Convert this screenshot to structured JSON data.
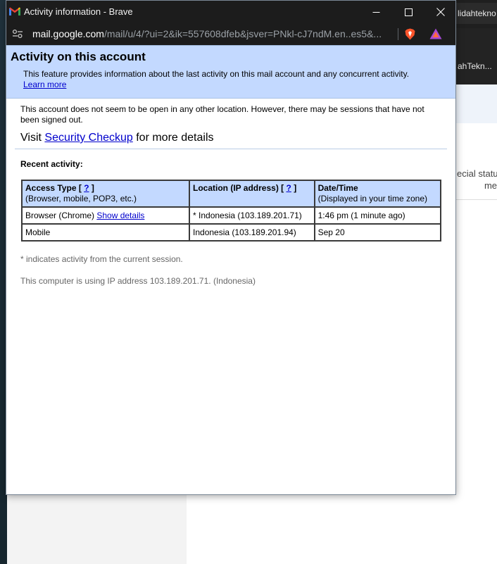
{
  "background": {
    "tab_label": "lidahtekno",
    "bookmark_label": "ahTekn...",
    "status_line1": "ecial statu",
    "status_line2": "me"
  },
  "window": {
    "title": "Activity information - Brave",
    "url_host": "mail.google.com",
    "url_path": "/mail/u/4/?ui=2&ik=557608dfeb&jsver=PNkl-cJ7ndM.en..es5&..."
  },
  "header": {
    "title": "Activity on this account",
    "description": "This feature provides information about the last activity on this mail account and any concurrent activity.",
    "learn_more": "Learn more"
  },
  "intro": "This account does not seem to be open in any other location. However, there may be sessions that have not been signed out.",
  "visit": {
    "prefix": "Visit ",
    "link": "Security Checkup",
    "suffix": " for more details"
  },
  "recent_title": "Recent activity:",
  "table": {
    "headers": [
      {
        "title": "Access Type",
        "sub": "(Browser, mobile, POP3, etc.)",
        "help": "?"
      },
      {
        "title": "Location (IP address)",
        "sub": "",
        "help": "?"
      },
      {
        "title": "Date/Time",
        "sub": "(Displayed in your time zone)",
        "help": ""
      }
    ],
    "rows": [
      {
        "access": "Browser (Chrome)",
        "details_link": "Show details",
        "location": "* Indonesia (103.189.201.71)",
        "time": "1:46 pm (1 minute ago)"
      },
      {
        "access": "Mobile",
        "details_link": "",
        "location": "Indonesia (103.189.201.94)",
        "time": "Sep 20"
      }
    ]
  },
  "note_current": "* indicates activity from the current session.",
  "note_ip": "This computer is using IP address 103.189.201.71. (Indonesia)",
  "colors": {
    "header_bg": "#c3d9ff",
    "link": "#0000cc",
    "titlebar": "#1c1c1c"
  },
  "icons": [
    "gmail-icon",
    "minimize-icon",
    "maximize-icon",
    "close-icon",
    "site-settings-icon",
    "brave-shields-icon",
    "brave-rewards-icon"
  ]
}
